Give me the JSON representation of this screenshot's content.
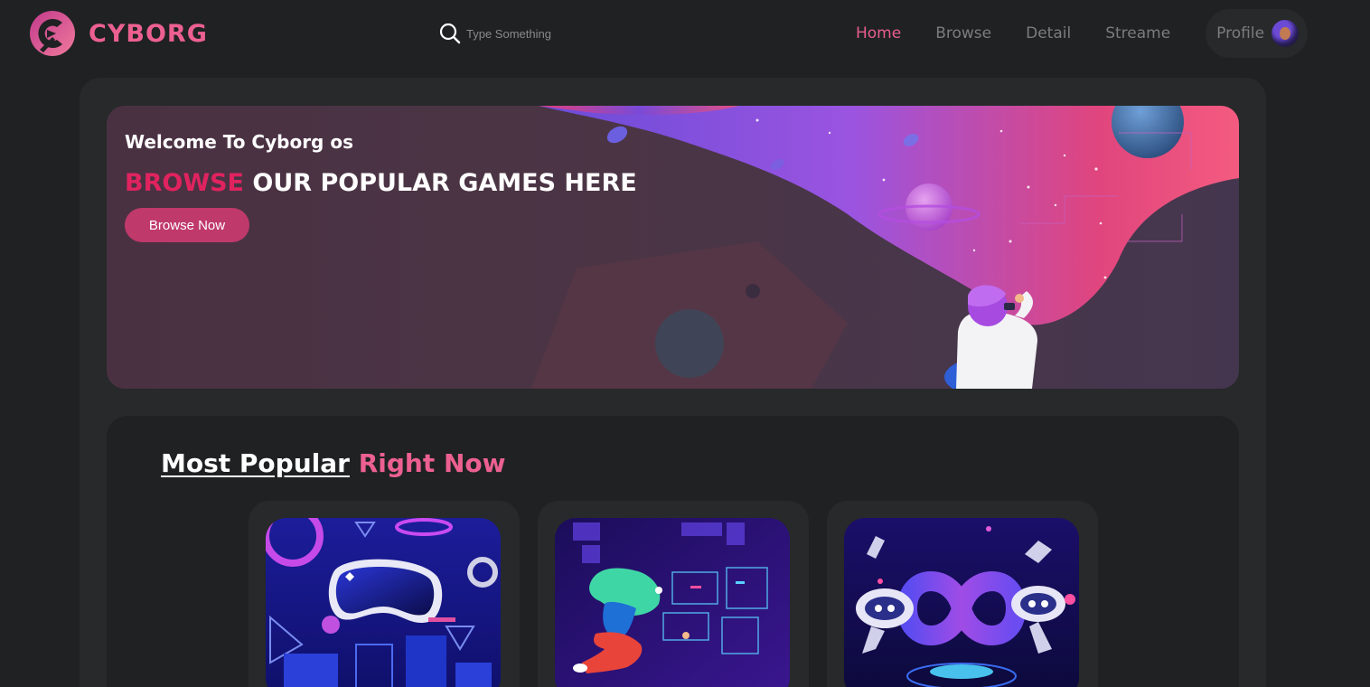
{
  "brand": {
    "name": "CYBORG",
    "accent": "#ec6090"
  },
  "search": {
    "placeholder": "Type Something",
    "icon": "search-icon"
  },
  "nav": {
    "items": [
      {
        "label": "Home",
        "active": true
      },
      {
        "label": "Browse",
        "active": false
      },
      {
        "label": "Detail",
        "active": false
      },
      {
        "label": "Streame",
        "active": false
      }
    ],
    "profile_label": "Profile"
  },
  "banner": {
    "subtitle": "Welcome To Cyborg os",
    "title_highlight": "BROWSE",
    "title_rest": " OUR POPULAR GAMES HERE",
    "button_label": "Browse Now"
  },
  "popular": {
    "heading_underlined": "Most Popular",
    "heading_highlight": "Right Now",
    "cards": [
      {
        "image": "vr-headset-illustration"
      },
      {
        "image": "floating-girl-hologram-illustration"
      },
      {
        "image": "robots-infinity-illustration"
      }
    ]
  }
}
